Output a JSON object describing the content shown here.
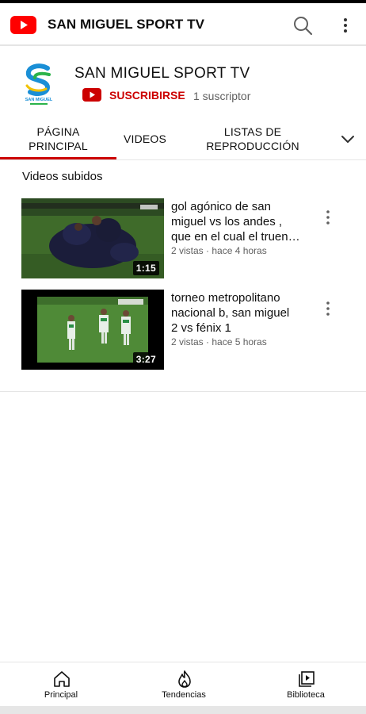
{
  "app_bar": {
    "title": "SAN MIGUEL SPORT TV",
    "logo_icon": "youtube-logo-icon",
    "search_icon": "search-icon",
    "more_icon": "more-vert-icon"
  },
  "channel": {
    "name": "SAN MIGUEL SPORT TV",
    "subscribe_label": "SUSCRIBIRSE",
    "subscriber_count": "1 suscriptor",
    "brand_color": "#cc0000"
  },
  "tabs": [
    {
      "label_line1": "PÁGINA",
      "label_line2": "PRINCIPAL",
      "active": true
    },
    {
      "label_line1": "VIDEOS",
      "label_line2": "",
      "active": false
    },
    {
      "label_line1": "LISTAS DE",
      "label_line2": "REPRODUCCIÓN",
      "active": false
    }
  ],
  "section": {
    "title": "Videos subidos"
  },
  "videos": [
    {
      "title_line1": "gol agónico de san",
      "title_line2": "miguel vs los andes ,",
      "title_line3": "que en el cual el truen…",
      "meta": "2 vistas · hace 4 horas",
      "duration": "1:15"
    },
    {
      "title_line1": "torneo metropolitano",
      "title_line2": "nacional b, san miguel",
      "title_line3": "2 vs fénix 1",
      "meta": "2 vistas · hace 5 horas",
      "duration": "3:27"
    }
  ],
  "bottom_nav": [
    {
      "label": "Principal",
      "icon": "home-icon"
    },
    {
      "label": "Tendencias",
      "icon": "flame-icon"
    },
    {
      "label": "Biblioteca",
      "icon": "library-icon"
    }
  ]
}
